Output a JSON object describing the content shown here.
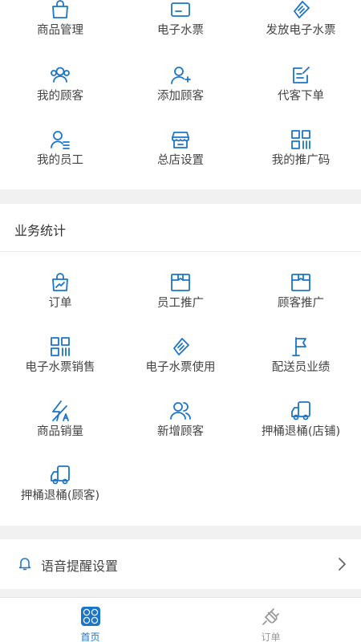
{
  "colors": {
    "accent": "#1b75c9",
    "tab_inactive": "#9a9a9a",
    "background": "#f1f1f1"
  },
  "top_grid": {
    "items": [
      {
        "label": "商品管理",
        "icon": "shopping-bag-icon"
      },
      {
        "label": "电子水票",
        "icon": "card-icon"
      },
      {
        "label": "发放电子水票",
        "icon": "ticket-icon"
      },
      {
        "label": "我的顾客",
        "icon": "users-icon"
      },
      {
        "label": "添加顾客",
        "icon": "add-user-icon"
      },
      {
        "label": "代客下单",
        "icon": "edit-note-icon"
      },
      {
        "label": "我的员工",
        "icon": "user-list-icon"
      },
      {
        "label": "总店设置",
        "icon": "storefront-icon"
      },
      {
        "label": "我的推广码",
        "icon": "qr-code-icon"
      }
    ]
  },
  "business_stats": {
    "title": "业务统计",
    "items": [
      {
        "label": "订单",
        "icon": "order-bag-icon"
      },
      {
        "label": "员工推广",
        "icon": "box-icon"
      },
      {
        "label": "顾客推广",
        "icon": "box-icon"
      },
      {
        "label": "电子水票销售",
        "icon": "qr-code-icon"
      },
      {
        "label": "电子水票使用",
        "icon": "ticket-icon"
      },
      {
        "label": "配送员业绩",
        "icon": "flag-icon"
      },
      {
        "label": "商品销量",
        "icon": "flash-icon"
      },
      {
        "label": "新增顾客",
        "icon": "users-icon"
      },
      {
        "label": "押桶退桶(店铺)",
        "icon": "truck-icon"
      },
      {
        "label": "押桶退桶(顾客)",
        "icon": "truck-icon"
      }
    ]
  },
  "settings": {
    "voice_reminder_label": "语音提醒设置"
  },
  "tabbar": {
    "home_label": "首页",
    "orders_label": "订单"
  }
}
